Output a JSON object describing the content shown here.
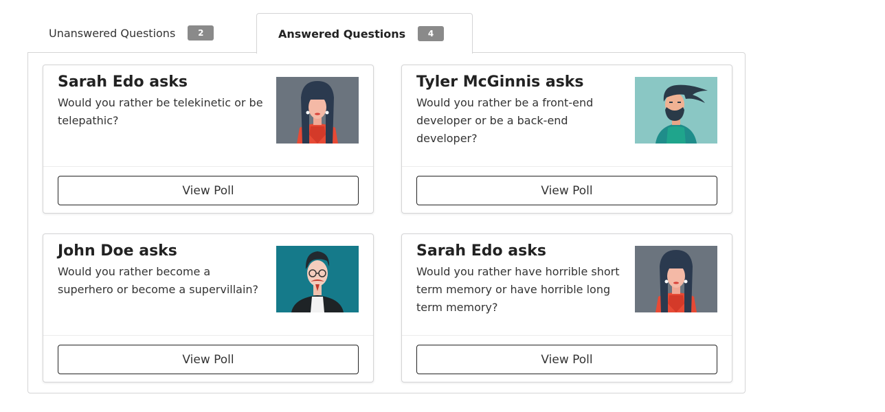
{
  "tabs": [
    {
      "label": "Unanswered Questions",
      "count": "2",
      "active": false
    },
    {
      "label": "Answered Questions",
      "count": "4",
      "active": true
    }
  ],
  "polls": [
    {
      "asker": "Sarah Edo asks",
      "question": "Would you rather be telekinetic or be telepathic?",
      "avatar": "sarah-edo-avatar",
      "button": "View Poll"
    },
    {
      "asker": "Tyler McGinnis asks",
      "question": "Would you rather be a front-end developer or be a back-end developer?",
      "avatar": "tyler-mcginnis-avatar",
      "button": "View Poll"
    },
    {
      "asker": "John Doe asks",
      "question": "Would you rather become a superhero or become a supervillain?",
      "avatar": "john-doe-avatar",
      "button": "View Poll"
    },
    {
      "asker": "Sarah Edo asks",
      "question": "Would you rather have horrible short term memory or have horrible long term memory?",
      "avatar": "sarah-edo-avatar",
      "button": "View Poll"
    }
  ],
  "colors": {
    "badge": "#8a8a8a",
    "border": "#d4d4d5",
    "button_border": "#222222"
  }
}
